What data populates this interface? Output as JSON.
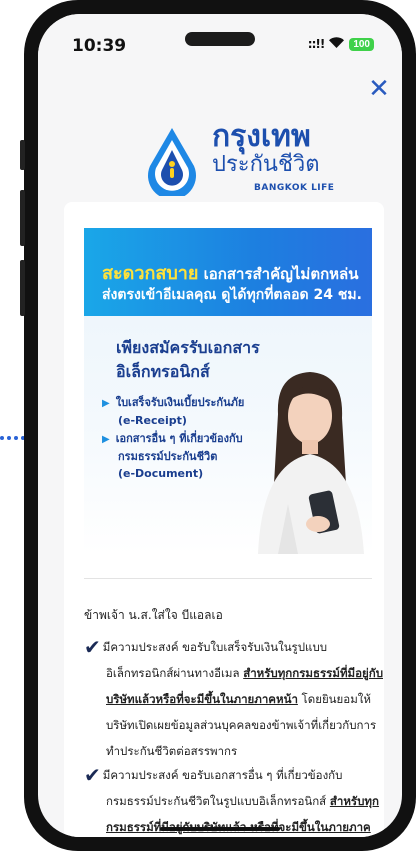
{
  "status_bar": {
    "time": "10:39",
    "signal": "::!!",
    "wifi": "◖",
    "battery": "100"
  },
  "close_label": "✕",
  "logo": {
    "thai_line1": "กรุงเทพ",
    "thai_line2": "ประกันชีวิต",
    "english": "BANGKOK LIFE"
  },
  "banner": {
    "headline_accent": "สะดวกสบาย",
    "headline_rest": " เอกสารสำคัญไม่ตกหล่น",
    "headline_line2": "ส่งตรงเข้าอีเมลคุณ ดูได้ทุกที่ตลอด 24 ชม.",
    "subtitle_line1": "เพียงสมัครรับเอกสาร",
    "subtitle_line2": "อิเล็กทรอนิกส์",
    "bullets": [
      {
        "line1": "ใบเสร็จรับเงินเบี้ยประกันภัย",
        "line2": "(e-Receipt)"
      },
      {
        "line1": "เอกสารอื่น ๆ ที่เกี่ยวข้องกับ",
        "line2": "กรมธรรม์ประกันชีวิต",
        "line3": "(e-Document)"
      }
    ]
  },
  "greeting": "ข้าพเจ้า น.ส.ใส่ใจ บีแอลเอ",
  "consents": [
    {
      "line1": "มีความประสงค์ ขอรับใบเสร็จรับเงินในรูปแบบ",
      "line2_plain": "อิเล็กทรอนิกส์ผ่านทางอีเมล ",
      "line2_link": "สำหรับทุกกรมธรรม์ที่มีอยู่กับ",
      "line3_link": "บริษัทแล้วหรือที่จะมีขึ้นในภายภาคหน้า",
      "line3_plain": " โดยยินยอมให้",
      "line4": "บริษัทเปิดเผยข้อมูลส่วนบุคคลของข้าพเจ้าที่เกี่ยวกับการ",
      "line5": "ทำประกันชีวิตต่อสรรพากร"
    },
    {
      "line1": "มีความประสงค์ ขอรับเอกสารอื่น ๆ ที่เกี่ยวข้องกับ",
      "line2_plain": "กรมธรรม์ประกันชีวิตในรูปแบบอิเล็กทรอนิกส์ ",
      "line2_link": "สำหรับทุก",
      "line3_link": "กรมธรรม์ที่มีอยู่กับบริษัทแล้ว หรือที่จะมีขึ้นในภายภาคหน้า"
    }
  ],
  "colors": {
    "brand": "#1d4fae",
    "banner_gradient_start": "#1aa7e8",
    "banner_gradient_end": "#2a6fe0",
    "accent_yellow": "#ffe23a",
    "close": "#2a5bbf"
  }
}
